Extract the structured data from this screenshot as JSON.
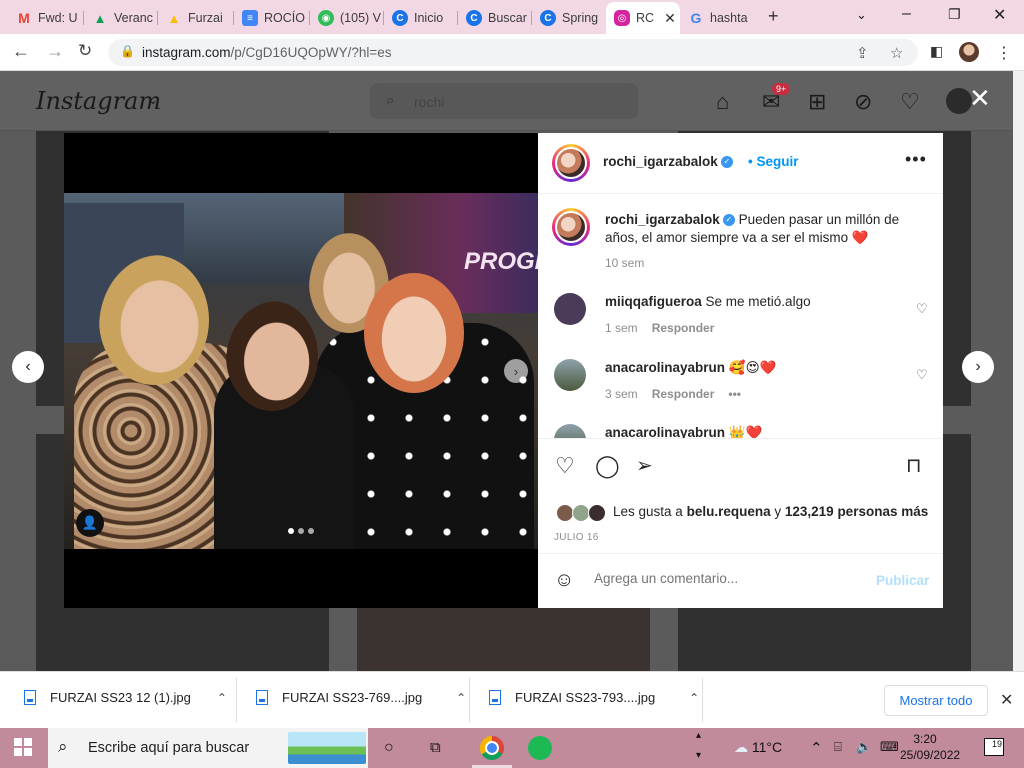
{
  "browser": {
    "tabs": [
      {
        "label": "Fwd: U",
        "fav_color": "#ea4335",
        "fav_glyph": "M"
      },
      {
        "label": "Veranc",
        "fav_color": "#0f9d58",
        "fav_glyph": "▲"
      },
      {
        "label": "Furzai",
        "fav_color": "#fbbc04",
        "fav_glyph": "▲"
      },
      {
        "label": "ROCÍO",
        "fav_color": "#4285f4",
        "fav_glyph": "≡"
      },
      {
        "label": "(105) V",
        "fav_color": "#2ebd59",
        "fav_glyph": "◉"
      },
      {
        "label": "Inicio",
        "fav_color": "#1a73e8",
        "fav_glyph": "C"
      },
      {
        "label": "Buscar",
        "fav_color": "#1a73e8",
        "fav_glyph": "C"
      },
      {
        "label": "Spring",
        "fav_color": "#1a73e8",
        "fav_glyph": "C"
      },
      {
        "label": "RC",
        "fav_color": "#d6249f",
        "fav_glyph": "◎"
      },
      {
        "label": "hashta",
        "fav_color": "#4285f4",
        "fav_glyph": "G"
      }
    ],
    "url_host": "instagram.com",
    "url_rest": "/p/CgD16UQOpWY/?hl=es"
  },
  "instagram": {
    "logo": "Instagram",
    "search_value": "rochi",
    "notif_count": "9+",
    "post": {
      "author": "rochi_igarzabalok",
      "follow_label": "Seguir",
      "caption_author": "rochi_igarzabalok",
      "caption": "Pueden pasar un millón de años, el amor siempre va a ser el mismo ❤️",
      "caption_age": "10 sem",
      "comments": [
        {
          "user": "miiqqafigueroa",
          "text": "Se me metió.algo",
          "age": "1 sem",
          "reply": "Responder",
          "color": "#4a3b58"
        },
        {
          "user": "anacarolinayabrun",
          "text": "🥰😍❤️",
          "age": "3 sem",
          "reply": "Responder",
          "more": "•••",
          "color": "#6d7f86"
        },
        {
          "user": "anacarolinayabrun",
          "text": "👑❤️",
          "color": "#6d7f86"
        }
      ],
      "likes_prefix": "Les gusta a",
      "likes_user": "belu.requena",
      "likes_and": "y",
      "likes_count": "123,219 personas más",
      "date": "JULIO 16",
      "comment_placeholder": "Agrega un comentario...",
      "publish_label": "Publicar"
    }
  },
  "downloads": {
    "files": [
      "FURZAI SS23 12 (1).jpg",
      "FURZAI SS23-769....jpg",
      "FURZAI SS23-793....jpg"
    ],
    "show_all": "Mostrar todo"
  },
  "taskbar": {
    "search_placeholder": "Escribe aquí para buscar",
    "temperature": "11°C",
    "time": "3:20",
    "date": "25/09/2022",
    "notif_count": "19"
  }
}
